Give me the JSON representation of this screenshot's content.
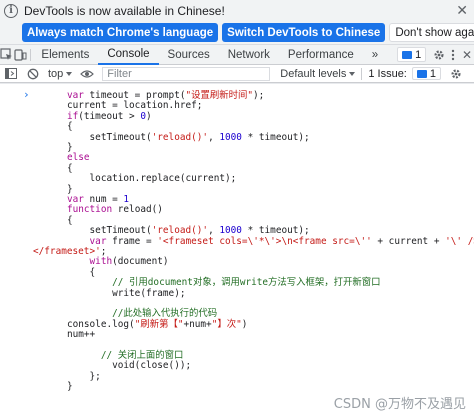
{
  "infobar": {
    "message": "DevTools is now available in Chinese!",
    "match_button": "Always match Chrome's language",
    "switch_button": "Switch DevTools to Chinese",
    "dont_show_button": "Don't show again"
  },
  "tabs": {
    "items": [
      "Elements",
      "Console",
      "Sources",
      "Network",
      "Performance"
    ],
    "more": "»",
    "issues_badge": "1"
  },
  "toolbar": {
    "context": "top",
    "filter_placeholder": "Filter",
    "levels": "Default levels",
    "issue_text": "1 Issue:",
    "issue_badge": "1"
  },
  "console": {
    "prompt": "›",
    "lines": [
      {
        "indent": 6,
        "segments": [
          {
            "t": "var ",
            "c": "kw"
          },
          {
            "t": "timeout = prompt(",
            "c": "fn"
          },
          {
            "t": "\"设置刷新时间\"",
            "c": "str"
          },
          {
            "t": ");",
            "c": "fn"
          }
        ]
      },
      {
        "indent": 6,
        "segments": [
          {
            "t": "current = location.href;",
            "c": "fn"
          }
        ]
      },
      {
        "indent": 6,
        "segments": [
          {
            "t": "if",
            "c": "kw"
          },
          {
            "t": "(timeout > ",
            "c": "fn"
          },
          {
            "t": "0",
            "c": "num"
          },
          {
            "t": ")",
            "c": "fn"
          }
        ]
      },
      {
        "indent": 6,
        "segments": [
          {
            "t": "{",
            "c": "fn"
          }
        ]
      },
      {
        "indent": 6,
        "segments": [
          {
            "t": "    setTimeout(",
            "c": "fn"
          },
          {
            "t": "'reload()'",
            "c": "str"
          },
          {
            "t": ", ",
            "c": "fn"
          },
          {
            "t": "1000",
            "c": "num"
          },
          {
            "t": " * timeout);",
            "c": "fn"
          }
        ]
      },
      {
        "indent": 6,
        "segments": [
          {
            "t": "}",
            "c": "fn"
          }
        ]
      },
      {
        "indent": 6,
        "segments": [
          {
            "t": "else",
            "c": "kw"
          }
        ]
      },
      {
        "indent": 6,
        "segments": [
          {
            "t": "{",
            "c": "fn"
          }
        ]
      },
      {
        "indent": 6,
        "segments": [
          {
            "t": "    location.replace(current);",
            "c": "fn"
          }
        ]
      },
      {
        "indent": 6,
        "segments": [
          {
            "t": "}",
            "c": "fn"
          }
        ]
      },
      {
        "indent": 6,
        "segments": [
          {
            "t": "var ",
            "c": "kw"
          },
          {
            "t": "num = ",
            "c": "fn"
          },
          {
            "t": "1",
            "c": "num"
          }
        ]
      },
      {
        "indent": 6,
        "segments": [
          {
            "t": "function ",
            "c": "kw"
          },
          {
            "t": "reload()",
            "c": "fn"
          }
        ]
      },
      {
        "indent": 6,
        "segments": [
          {
            "t": "{",
            "c": "fn"
          }
        ]
      },
      {
        "indent": 6,
        "segments": [
          {
            "t": "    setTimeout(",
            "c": "fn"
          },
          {
            "t": "'reload()'",
            "c": "str"
          },
          {
            "t": ", ",
            "c": "fn"
          },
          {
            "t": "1000",
            "c": "num"
          },
          {
            "t": " * timeout);",
            "c": "fn"
          }
        ]
      },
      {
        "indent": 6,
        "segments": [
          {
            "t": "    ",
            "c": "fn"
          },
          {
            "t": "var ",
            "c": "kw"
          },
          {
            "t": "frame = ",
            "c": "fn"
          },
          {
            "t": "'<frameset cols=\\'*\\'>\\n<frame src=\\''",
            "c": "str"
          },
          {
            "t": " + current + ",
            "c": "fn"
          },
          {
            "t": "'\\' />",
            "c": "str"
          }
        ]
      },
      {
        "indent": 0,
        "segments": [
          {
            "t": "</frameset>'",
            "c": "str"
          },
          {
            "t": ";",
            "c": "fn"
          }
        ]
      },
      {
        "indent": 6,
        "segments": [
          {
            "t": "    ",
            "c": "fn"
          },
          {
            "t": "with",
            "c": "kw"
          },
          {
            "t": "(document)",
            "c": "fn"
          }
        ]
      },
      {
        "indent": 6,
        "segments": [
          {
            "t": "    {",
            "c": "fn"
          }
        ]
      },
      {
        "indent": 6,
        "segments": [
          {
            "t": "        ",
            "c": "fn"
          },
          {
            "t": "// 引用document对象，调用write方法写入框架，打开新窗口",
            "c": "cmt"
          }
        ]
      },
      {
        "indent": 6,
        "segments": [
          {
            "t": "        write(frame);",
            "c": "fn"
          }
        ]
      },
      {
        "indent": 6,
        "segments": [
          {
            "t": "",
            "c": "fn"
          }
        ]
      },
      {
        "indent": 6,
        "segments": [
          {
            "t": "        ",
            "c": "fn"
          },
          {
            "t": "//此处输入代执行的代码",
            "c": "cmt"
          }
        ]
      },
      {
        "indent": 6,
        "segments": [
          {
            "t": "console.log(",
            "c": "fn"
          },
          {
            "t": "\"刷新第【\"",
            "c": "str"
          },
          {
            "t": "+num+",
            "c": "fn"
          },
          {
            "t": "\"】次\"",
            "c": "str"
          },
          {
            "t": ")",
            "c": "fn"
          }
        ]
      },
      {
        "indent": 6,
        "segments": [
          {
            "t": "num++",
            "c": "fn"
          }
        ]
      },
      {
        "indent": 6,
        "segments": [
          {
            "t": "",
            "c": "fn"
          }
        ]
      },
      {
        "indent": 6,
        "segments": [
          {
            "t": "      ",
            "c": "fn"
          },
          {
            "t": "// 关闭上面的窗口",
            "c": "cmt"
          }
        ]
      },
      {
        "indent": 6,
        "segments": [
          {
            "t": "        void(close());",
            "c": "fn"
          }
        ]
      },
      {
        "indent": 6,
        "segments": [
          {
            "t": "    };",
            "c": "fn"
          }
        ]
      },
      {
        "indent": 6,
        "segments": [
          {
            "t": "}",
            "c": "fn"
          }
        ]
      }
    ]
  },
  "watermark": "CSDN @万物不及遇见"
}
